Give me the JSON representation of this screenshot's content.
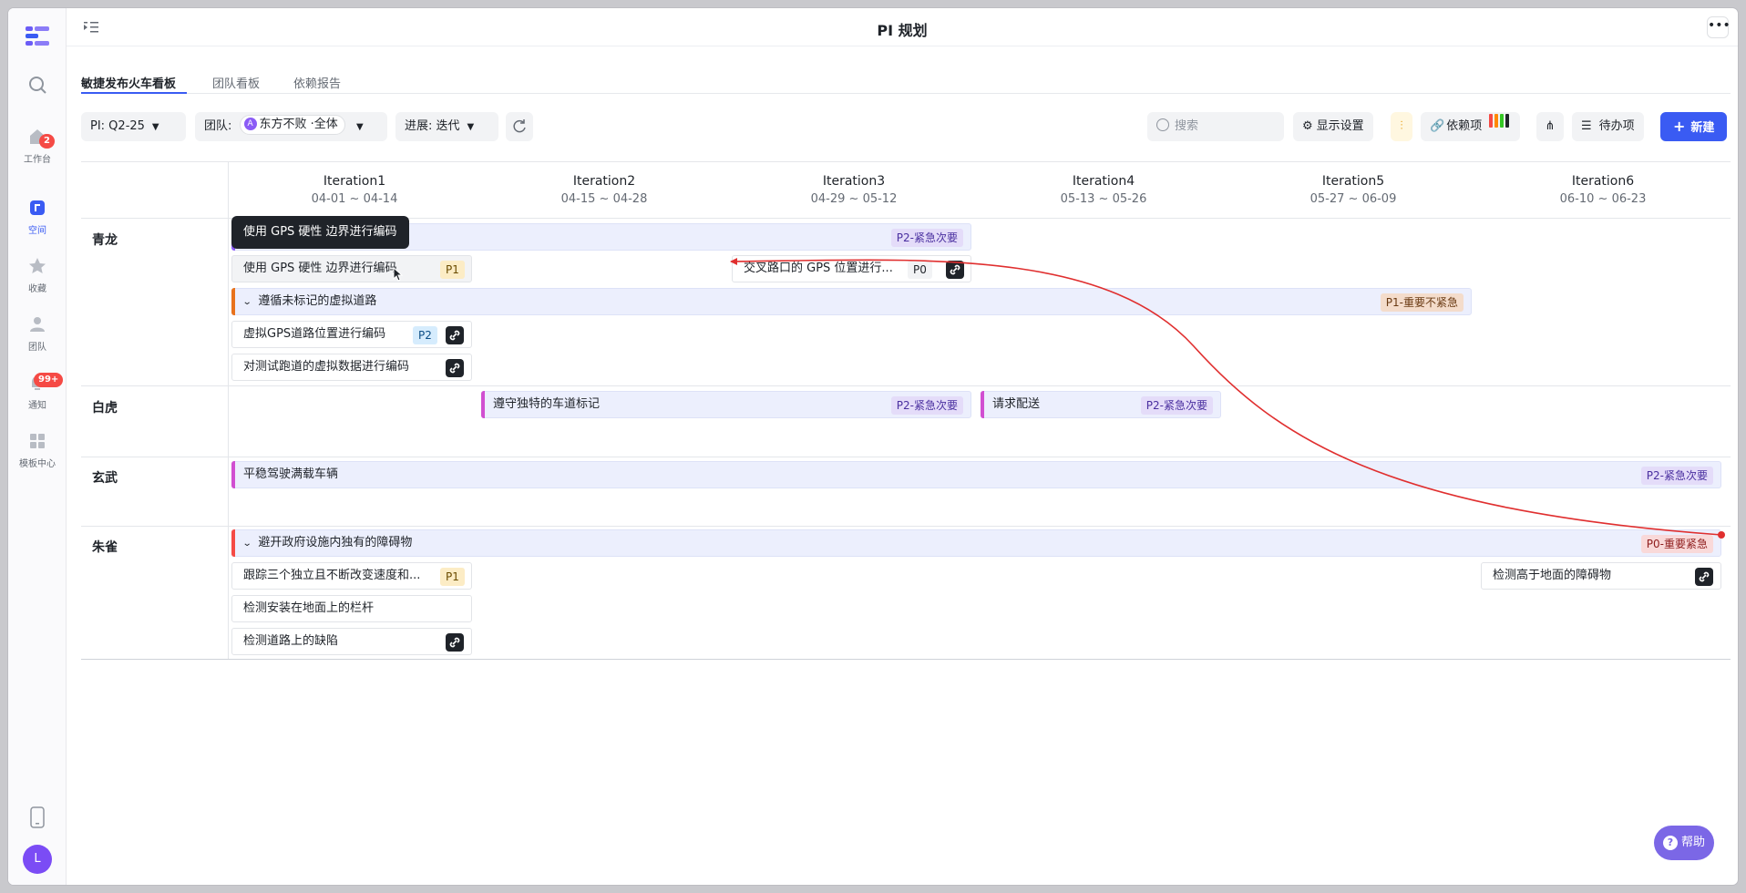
{
  "page": {
    "title": "PI 规划"
  },
  "rail": {
    "items": [
      {
        "label": "工作台",
        "badge": "2"
      },
      {
        "label": "空间"
      },
      {
        "label": "收藏"
      },
      {
        "label": "团队"
      },
      {
        "label": "通知",
        "badge": "99+"
      },
      {
        "label": "模板中心"
      }
    ],
    "avatar": "L"
  },
  "tabs": [
    "敏捷发布火车看板",
    "团队看板",
    "依赖报告"
  ],
  "toolbar": {
    "pi": "PI:  Q2-25",
    "team_label": "团队:",
    "team_value": "东方不败 ·全体",
    "progress": "进展:  迭代",
    "search_placeholder": "搜索",
    "display_settings": "显示设置",
    "dependencies": "依赖项",
    "todo": "待办项",
    "new": "新建",
    "dep_colors": [
      "#f54a45",
      "#ff8800",
      "#34c724",
      "#1f2329"
    ]
  },
  "iterations": [
    {
      "name": "Iteration1",
      "dates": "04-01 ~ 04-14"
    },
    {
      "name": "Iteration2",
      "dates": "04-15 ~ 04-28"
    },
    {
      "name": "Iteration3",
      "dates": "04-29 ~ 05-12"
    },
    {
      "name": "Iteration4",
      "dates": "05-13 ~ 05-26"
    },
    {
      "name": "Iteration5",
      "dates": "05-27 ~ 06-09"
    },
    {
      "name": "Iteration6",
      "dates": "06-10 ~ 06-23"
    }
  ],
  "lanes": [
    {
      "name": "青龙",
      "epics": [
        {
          "title": "",
          "tag": "P2-紧急次要",
          "color": "#8b5cf6"
        },
        {
          "title": "遵循未标记的虚拟道路",
          "tag": "P1-重要不紧急",
          "color": "#e8721c"
        }
      ],
      "cards": [
        {
          "title": "使用 GPS 硬性 边界进行编码",
          "priority": "P1"
        },
        {
          "title": "交叉路口的 GPS 位置进行...",
          "priority": "P0"
        },
        {
          "title": "虚拟GPS道路位置进行编码",
          "priority": "P2"
        },
        {
          "title": "对测试跑道的虚拟数据进行编码"
        }
      ]
    },
    {
      "name": "白虎",
      "epics": [
        {
          "title": "遵守独特的车道标记",
          "tag": "P2-紧急次要",
          "color": "#d14fd1"
        },
        {
          "title": "请求配送",
          "tag": "P2-紧急次要",
          "color": "#d14fd1"
        }
      ]
    },
    {
      "name": "玄武",
      "epics": [
        {
          "title": "平稳驾驶满载车辆",
          "tag": "P2-紧急次要",
          "color": "#d14fd1"
        }
      ]
    },
    {
      "name": "朱雀",
      "epics": [
        {
          "title": "避开政府设施内独有的障碍物",
          "tag": "P0-重要紧急",
          "color": "#f54a45"
        }
      ],
      "cards": [
        {
          "title": "跟踪三个独立且不断改变速度和...",
          "priority": "P1"
        },
        {
          "title": "检测安装在地面上的栏杆"
        },
        {
          "title": "检测道路上的缺陷"
        },
        {
          "title": "检测高于地面的障碍物"
        }
      ]
    }
  ],
  "tooltip": "使用 GPS 硬性 边界进行编码",
  "help": "帮助"
}
